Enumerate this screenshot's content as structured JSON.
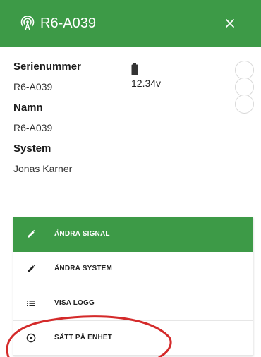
{
  "header": {
    "title": "R6-A039",
    "background_color": "#3d9a47",
    "antenna_icon": "antenna-icon",
    "close_icon": "close-icon"
  },
  "info": {
    "serial_label": "Serienummer",
    "serial_value": "R6-A039",
    "name_label": "Namn",
    "name_value": "R6-A039",
    "system_label": "System",
    "system_value": "Jonas Karner"
  },
  "battery": {
    "icon": "battery-icon",
    "voltage": "12.34v"
  },
  "menu": {
    "active_color": "#3d9a47",
    "items": [
      {
        "label": "ÄNDRA SIGNAL",
        "icon": "pencil-icon",
        "active": true
      },
      {
        "label": "ÄNDRA SYSTEM",
        "icon": "pencil-icon",
        "active": false
      },
      {
        "label": "VISA LOGG",
        "icon": "list-icon",
        "active": false
      },
      {
        "label": "SÄTT PÅ ENHET",
        "icon": "power-circle-icon",
        "active": false
      }
    ]
  },
  "annotation": {
    "shape": "ellipse",
    "color": "#d42a2a"
  }
}
